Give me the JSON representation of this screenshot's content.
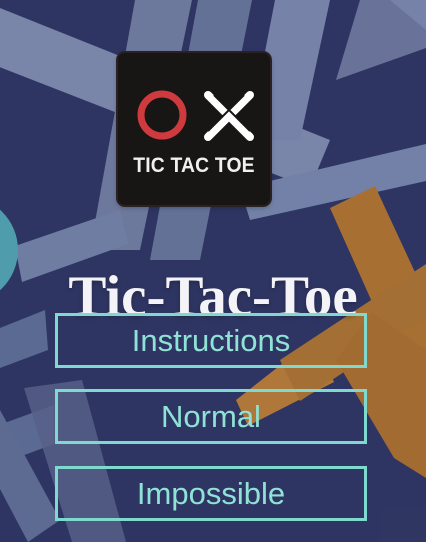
{
  "logo": {
    "text": "TIC TAC TOE",
    "icon_o": "o-mark-icon",
    "icon_x": "x-mark-icon"
  },
  "title": "Tic-Tac-Toe",
  "menu": [
    {
      "label": "Instructions"
    },
    {
      "label": "Normal"
    },
    {
      "label": "Impossible"
    }
  ],
  "colors": {
    "background": "#343a68",
    "button_border": "#7fd9cf",
    "button_text": "#8fe2d6",
    "title": "#f4f4f8",
    "logo_bg": "#181515",
    "logo_o": "#cf3a3f",
    "logo_x": "#ffffff"
  }
}
